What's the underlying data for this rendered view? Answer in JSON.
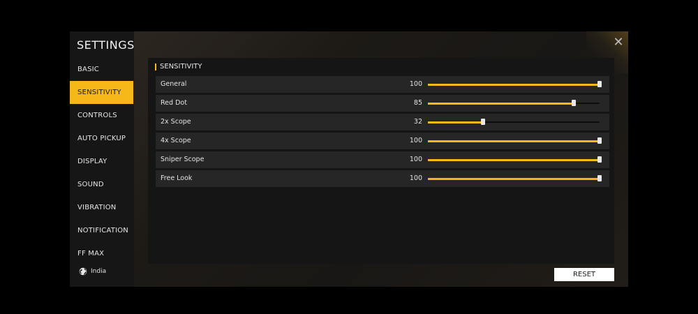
{
  "sidebar": {
    "title": "SETTINGS",
    "items": [
      {
        "label": "BASIC",
        "active": false
      },
      {
        "label": "SENSITIVITY",
        "active": true
      },
      {
        "label": "CONTROLS",
        "active": false
      },
      {
        "label": "AUTO PICKUP",
        "active": false
      },
      {
        "label": "DISPLAY",
        "active": false
      },
      {
        "label": "SOUND",
        "active": false
      },
      {
        "label": "VIBRATION",
        "active": false
      },
      {
        "label": "NOTIFICATION",
        "active": false
      },
      {
        "label": "FF MAX",
        "active": false
      }
    ],
    "region": {
      "icon": "globe-icon",
      "label": "India"
    }
  },
  "close": {
    "icon": "close-icon",
    "symbol": "✕"
  },
  "section": {
    "title": "SENSITIVITY",
    "rows": [
      {
        "label": "General",
        "value": "100",
        "level": 100
      },
      {
        "label": "Red Dot",
        "value": "85",
        "level": 85
      },
      {
        "label": "2x Scope",
        "value": "32",
        "level": 32
      },
      {
        "label": "4x Scope",
        "value": "100",
        "level": 100
      },
      {
        "label": "Sniper Scope",
        "value": "100",
        "level": 100
      },
      {
        "label": "Free Look",
        "value": "100",
        "level": 100
      }
    ]
  },
  "reset": {
    "label": "RESET"
  },
  "colors": {
    "accent": "#f5b818",
    "panel": "#151515",
    "row": "#262626"
  }
}
